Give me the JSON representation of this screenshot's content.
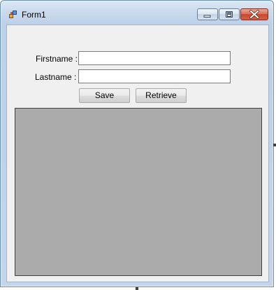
{
  "window": {
    "title": "Form1",
    "icon": "form-app-icon"
  },
  "caption_buttons": {
    "minimize_icon": "minimize-icon",
    "maximize_icon": "maximize-icon",
    "close_icon": "close-icon",
    "close_color": "#c44a30"
  },
  "form": {
    "firstname_label": "Firstname :",
    "lastname_label": "Lastname :",
    "firstname_value": "",
    "lastname_value": "",
    "save_label": "Save",
    "retrieve_label": "Retrieve"
  },
  "grid": {
    "background_color": "#ababab"
  }
}
